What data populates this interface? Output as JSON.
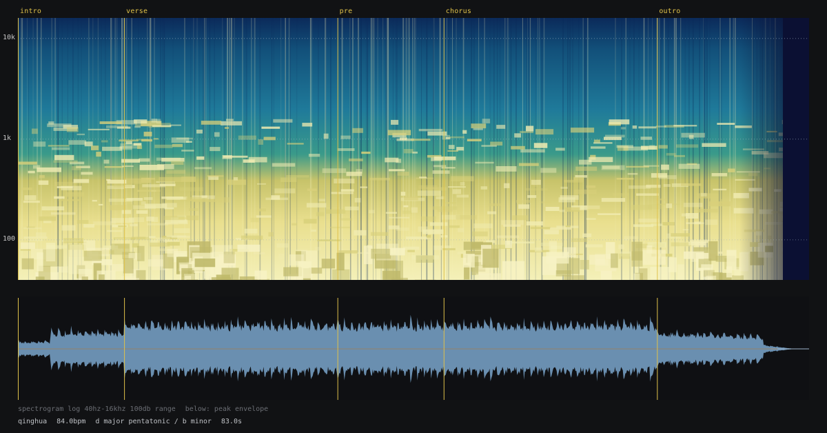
{
  "sections": [
    {
      "label": "intro",
      "time": 0.0
    },
    {
      "label": "verse",
      "time": 11.4
    },
    {
      "label": "pre",
      "time": 34.3
    },
    {
      "label": "chorus",
      "time": 45.7
    },
    {
      "label": "outro",
      "time": 68.6
    }
  ],
  "duration_s": 83.0,
  "frequency_axis": {
    "scale": "log",
    "min_hz": 40,
    "max_hz": 16000,
    "ticks": [
      {
        "label": "10k",
        "hz": 10000
      },
      {
        "label": "1k",
        "hz": 1000
      },
      {
        "label": "100",
        "hz": 100
      }
    ]
  },
  "captions": {
    "description": "spectrogram log 40hz-16khz 100db range",
    "below_note": "below: peak envelope",
    "track_name": "qinghua",
    "bpm": "84.0bpm",
    "key": "d major pentatonic / b minor",
    "length": "83.0s"
  },
  "colors": {
    "background": "#111214",
    "section_marker": "#e0c24a",
    "waveform_fill": "#6a8fb0",
    "waveform_centerline": "#b07a3a",
    "spectrogram_low": "#0b1033",
    "spectrogram_mid": "#1f7a9a",
    "spectrogram_high": "#f4f0b8"
  }
}
